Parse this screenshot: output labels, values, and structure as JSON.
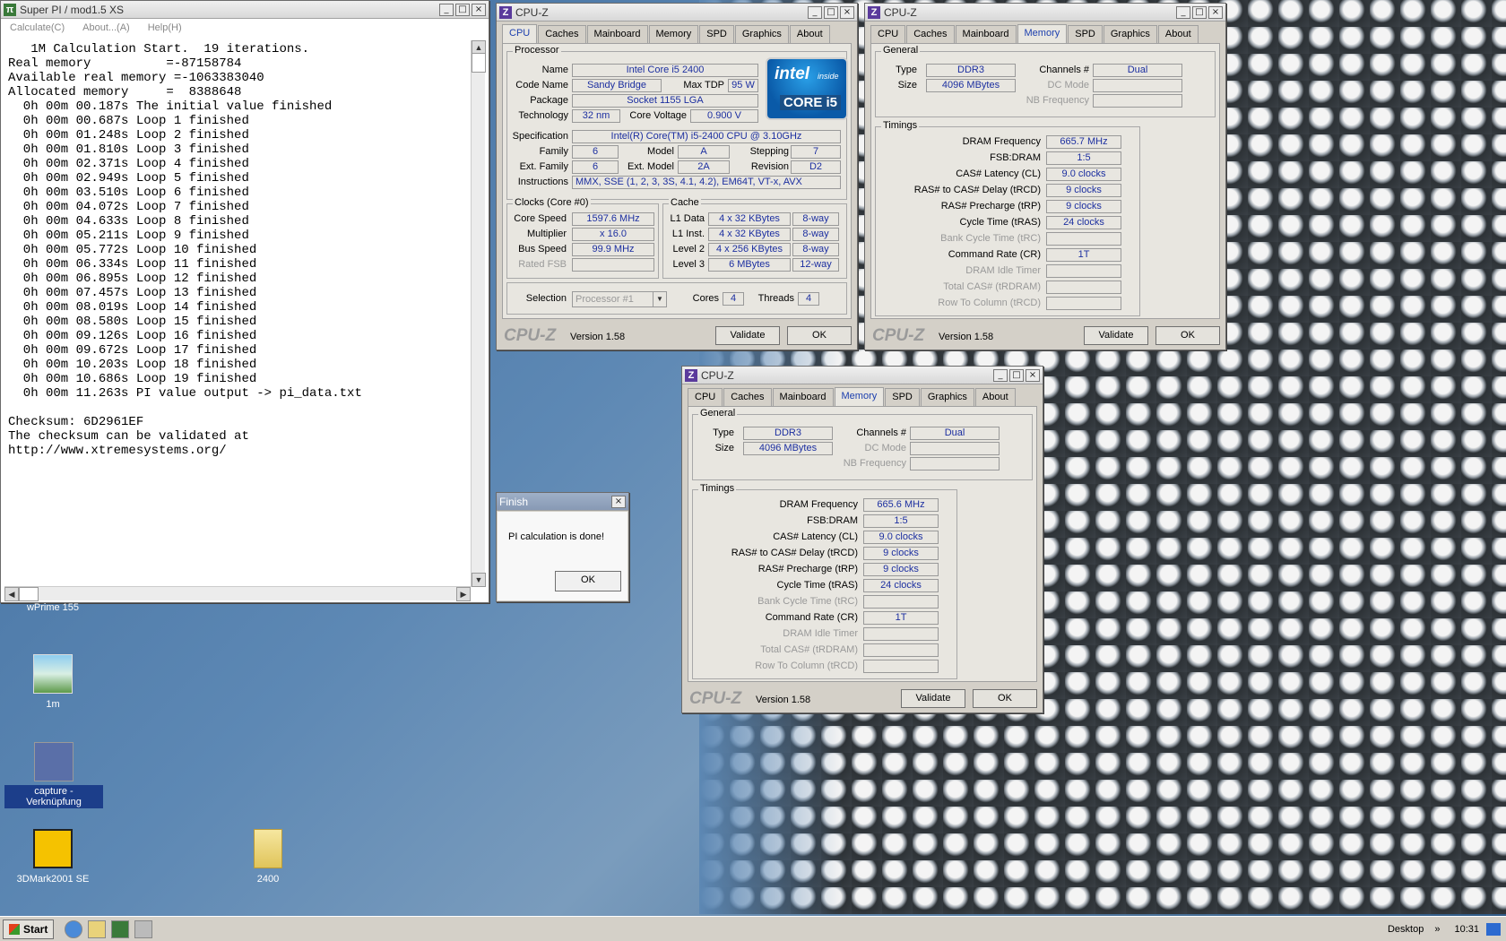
{
  "superpi": {
    "title": "Super PI / mod1.5 XS",
    "menu": [
      "Calculate(C)",
      "About...(A)",
      "Help(H)"
    ],
    "log": [
      "   1M Calculation Start.  19 iterations.",
      "Real memory          =-87158784",
      "Available real memory =-1063383040",
      "Allocated memory     =  8388648",
      "  0h 00m 00.187s The initial value finished",
      "  0h 00m 00.687s Loop 1 finished",
      "  0h 00m 01.248s Loop 2 finished",
      "  0h 00m 01.810s Loop 3 finished",
      "  0h 00m 02.371s Loop 4 finished",
      "  0h 00m 02.949s Loop 5 finished",
      "  0h 00m 03.510s Loop 6 finished",
      "  0h 00m 04.072s Loop 7 finished",
      "  0h 00m 04.633s Loop 8 finished",
      "  0h 00m 05.211s Loop 9 finished",
      "  0h 00m 05.772s Loop 10 finished",
      "  0h 00m 06.334s Loop 11 finished",
      "  0h 00m 06.895s Loop 12 finished",
      "  0h 00m 07.457s Loop 13 finished",
      "  0h 00m 08.019s Loop 14 finished",
      "  0h 00m 08.580s Loop 15 finished",
      "  0h 00m 09.126s Loop 16 finished",
      "  0h 00m 09.672s Loop 17 finished",
      "  0h 00m 10.203s Loop 18 finished",
      "  0h 00m 10.686s Loop 19 finished",
      "  0h 00m 11.263s PI value output -> pi_data.txt",
      "",
      "Checksum: 6D2961EF",
      "The checksum can be validated at",
      "http://www.xtremesystems.org/"
    ]
  },
  "cpuz_title": "CPU-Z",
  "tabs": [
    "CPU",
    "Caches",
    "Mainboard",
    "Memory",
    "SPD",
    "Graphics",
    "About"
  ],
  "footer": {
    "logo": "CPU-Z",
    "version": "Version 1.58",
    "validate": "Validate",
    "ok": "OK"
  },
  "cpu": {
    "processor_group": "Processor",
    "name_label": "Name",
    "name": "Intel Core i5 2400",
    "codename_label": "Code Name",
    "codename": "Sandy Bridge",
    "maxtdp_label": "Max TDP",
    "maxtdp": "95 W",
    "package_label": "Package",
    "package": "Socket 1155 LGA",
    "tech_label": "Technology",
    "tech": "32 nm",
    "voltage_label": "Core Voltage",
    "voltage": "0.900 V",
    "spec_label": "Specification",
    "spec": "Intel(R) Core(TM) i5-2400 CPU @ 3.10GHz",
    "family_label": "Family",
    "family": "6",
    "model_label": "Model",
    "model": "A",
    "stepping_label": "Stepping",
    "stepping": "7",
    "extfamily_label": "Ext. Family",
    "extfamily": "6",
    "extmodel_label": "Ext. Model",
    "extmodel": "2A",
    "revision_label": "Revision",
    "revision": "D2",
    "instr_label": "Instructions",
    "instr": "MMX, SSE (1, 2, 3, 3S, 4.1, 4.2), EM64T, VT-x, AVX",
    "clocks_group": "Clocks (Core #0)",
    "corespeed_label": "Core Speed",
    "corespeed": "1597.6 MHz",
    "mult_label": "Multiplier",
    "mult": "x 16.0",
    "bus_label": "Bus Speed",
    "bus": "99.9 MHz",
    "ratedfsb_label": "Rated FSB",
    "ratedfsb": "",
    "cache_group": "Cache",
    "l1d_label": "L1 Data",
    "l1d": "4 x 32 KBytes",
    "l1d_way": "8-way",
    "l1i_label": "L1 Inst.",
    "l1i": "4 x 32 KBytes",
    "l1i_way": "8-way",
    "l2_label": "Level 2",
    "l2": "4 x 256 KBytes",
    "l2_way": "8-way",
    "l3_label": "Level 3",
    "l3": "6 MBytes",
    "l3_way": "12-way",
    "selection_label": "Selection",
    "selection": "Processor #1",
    "cores_label": "Cores",
    "cores": "4",
    "threads_label": "Threads",
    "threads": "4",
    "logo_text": "intel",
    "logo_inside": "inside",
    "logo_brand": "CORE i5"
  },
  "mem_labels": {
    "general": "General",
    "type": "Type",
    "size": "Size",
    "channels": "Channels #",
    "dcmode": "DC Mode",
    "nbfreq": "NB Frequency",
    "timings": "Timings",
    "dramfreq": "DRAM Frequency",
    "fsbdram": "FSB:DRAM",
    "cl": "CAS# Latency (CL)",
    "trcd": "RAS# to CAS# Delay (tRCD)",
    "trp": "RAS# Precharge (tRP)",
    "tras": "Cycle Time (tRAS)",
    "trc": "Bank Cycle Time (tRC)",
    "cr": "Command Rate (CR)",
    "idle": "DRAM Idle Timer",
    "trdram": "Total CAS# (tRDRAM)",
    "rtc": "Row To Column (tRCD)"
  },
  "mem1": {
    "type": "DDR3",
    "size": "4096 MBytes",
    "channels": "Dual",
    "dramfreq": "665.7 MHz",
    "fsbdram": "1:5",
    "cl": "9.0 clocks",
    "trcd": "9 clocks",
    "trp": "9 clocks",
    "tras": "24 clocks",
    "cr": "1T"
  },
  "mem2": {
    "type": "DDR3",
    "size": "4096 MBytes",
    "channels": "Dual",
    "dramfreq": "665.6 MHz",
    "fsbdram": "1:5",
    "cl": "9.0 clocks",
    "trcd": "9 clocks",
    "trp": "9 clocks",
    "tras": "24 clocks",
    "cr": "1T"
  },
  "finish": {
    "title": "Finish",
    "message": "PI calculation is done!",
    "ok": "OK"
  },
  "desktop": {
    "wprime": "wPrime 155",
    "icon_1m": "1m",
    "capture": "capture - Verknüpfung",
    "mark": "3DMark2001 SE",
    "folder": "2400"
  },
  "taskbar": {
    "start": "Start",
    "desktop": "Desktop",
    "clock": "10:31"
  }
}
